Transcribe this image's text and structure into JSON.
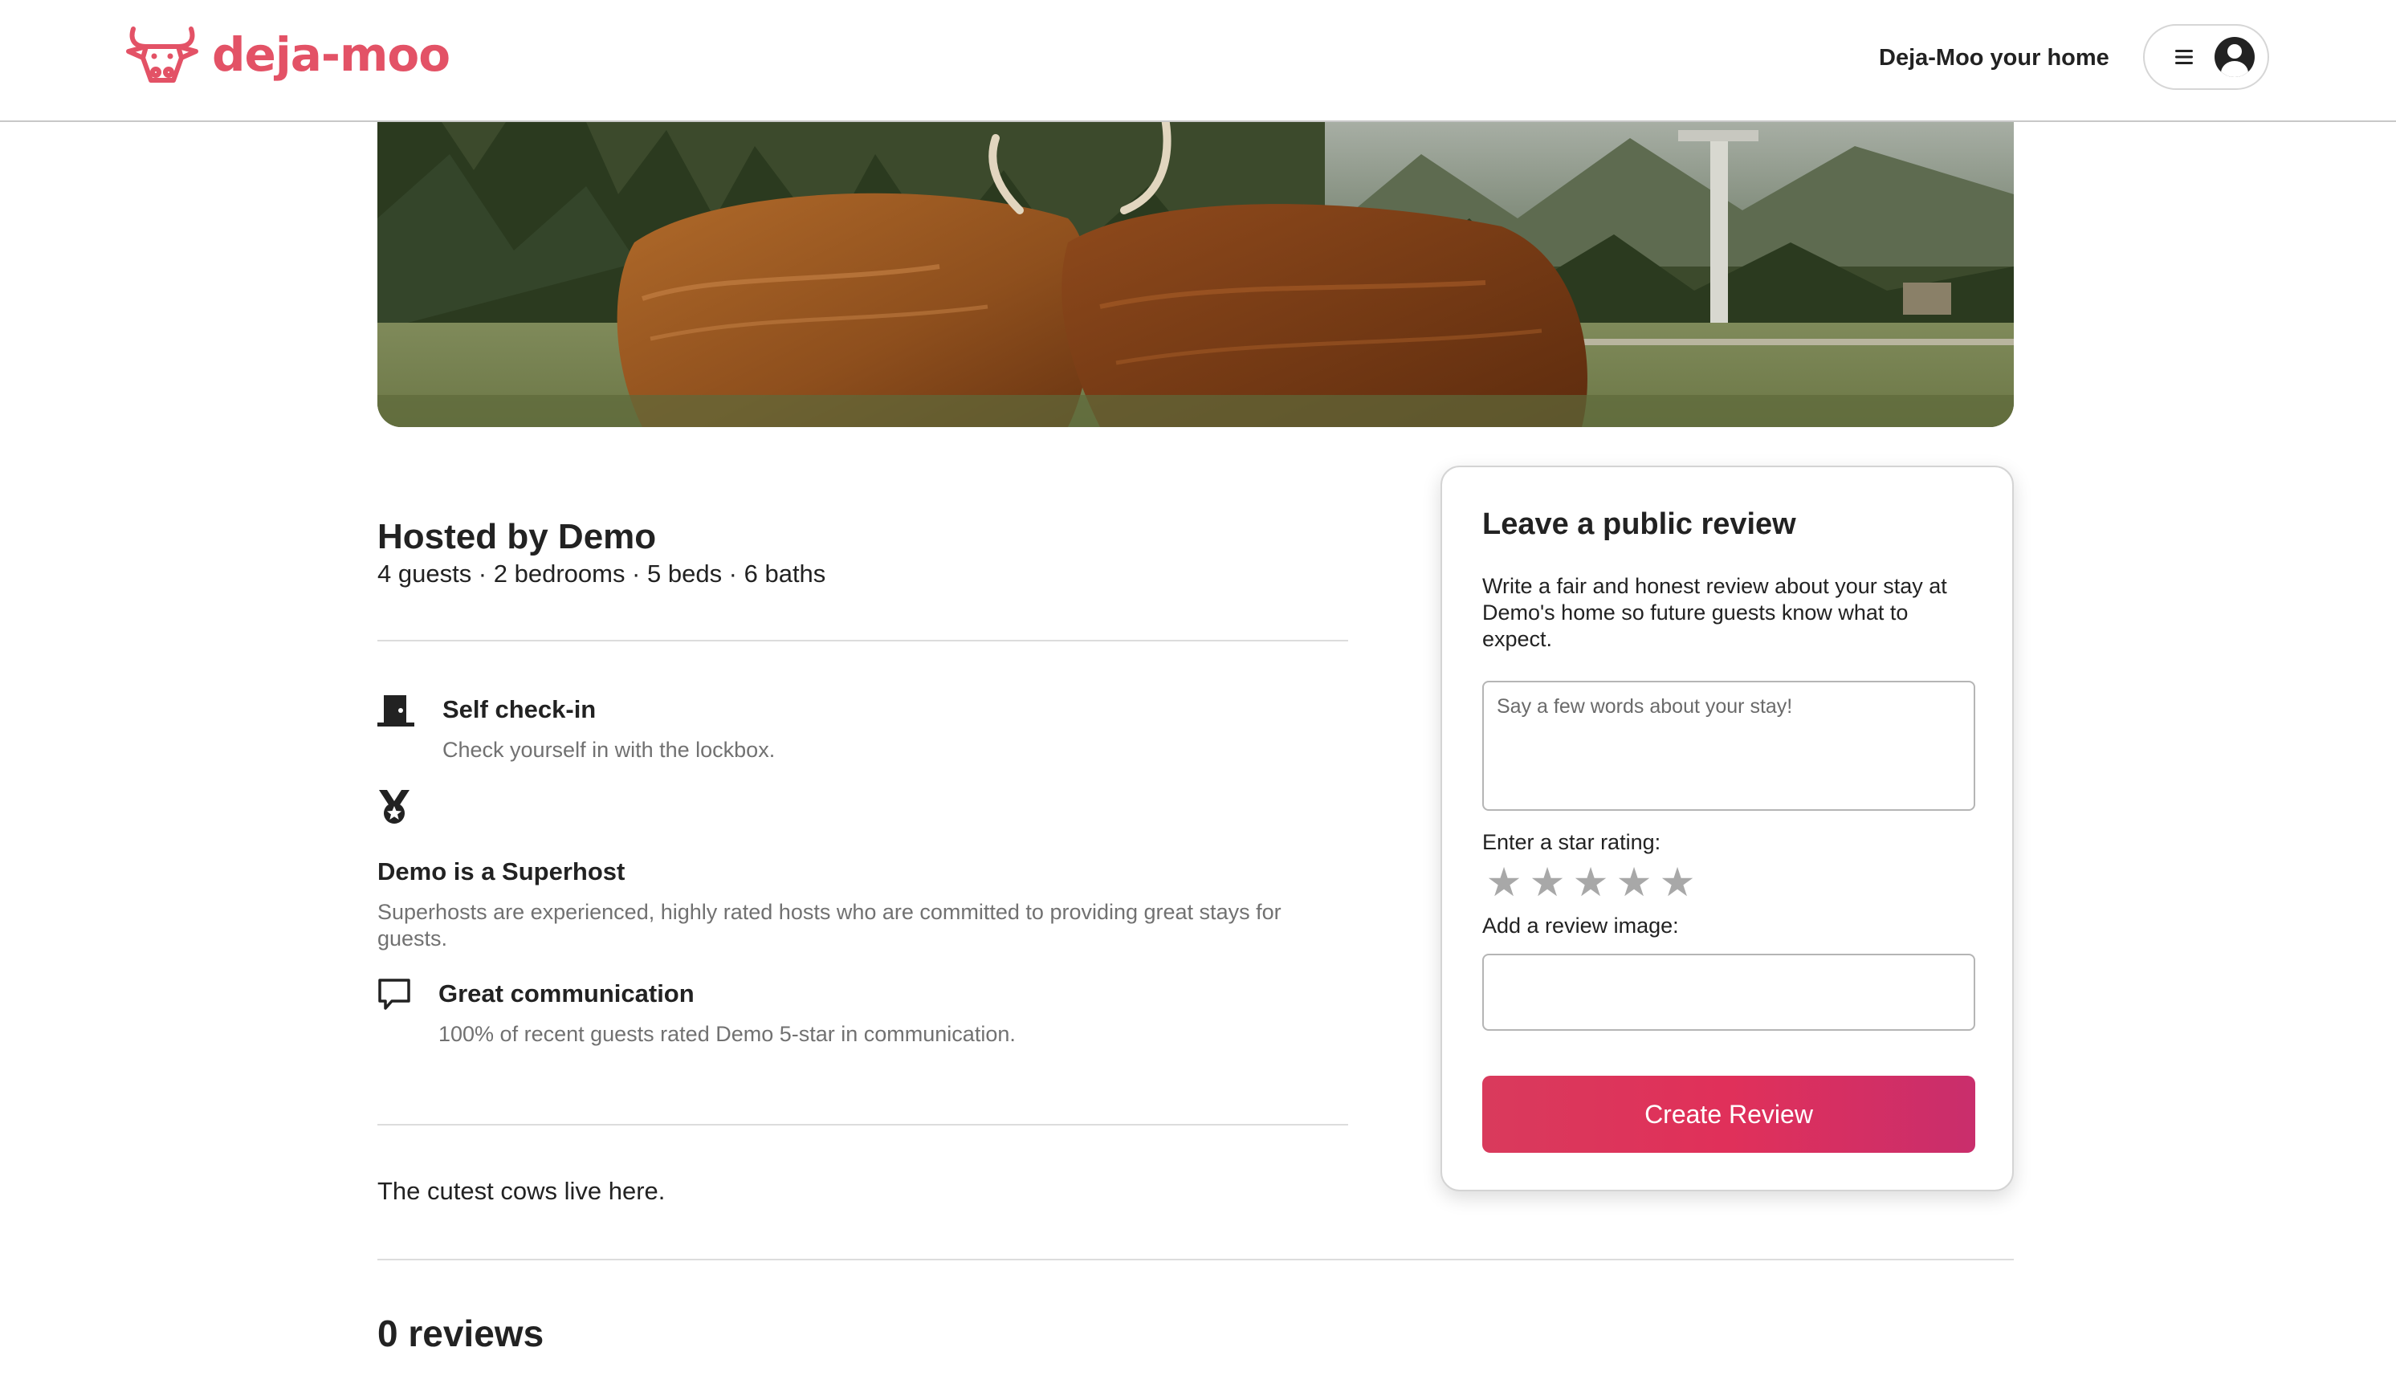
{
  "header": {
    "logo_text": "deja-moo",
    "nav_link": "Deja-Moo your home"
  },
  "listing": {
    "host_title": "Hosted by Demo",
    "host_sub": "4 guests · 2 bedrooms · 5 beds · 6 baths",
    "features": [
      {
        "icon": "door-icon",
        "title": "Self check-in",
        "desc": "Check yourself in with the lockbox."
      },
      {
        "icon": "medal-icon",
        "title": "Demo is a Superhost",
        "desc": "Superhosts are experienced, highly rated hosts who are committed to providing great stays for guests."
      },
      {
        "icon": "chat-icon",
        "title": "Great communication",
        "desc": "100% of recent guests rated Demo 5-star in communication."
      }
    ],
    "description": "The cutest cows live here.",
    "reviews_count": "0 reviews"
  },
  "review_form": {
    "title": "Leave a public review",
    "text": "Write a fair and honest review about your stay at Demo's home so future guests know what to expect.",
    "review_placeholder": "Say a few words about your stay!",
    "review_value": "",
    "star_label": "Enter a star rating:",
    "stars": [
      "★",
      "★",
      "★",
      "★",
      "★"
    ],
    "rating": 0,
    "image_label": "Add a review image:",
    "image_value": "",
    "submit_label": "Create Review"
  },
  "colors": {
    "brand": "#e35266",
    "button_gradient_start": "#d93a5c",
    "button_gradient_end": "#c92e6c",
    "star_inactive": "#a8a8a8"
  }
}
